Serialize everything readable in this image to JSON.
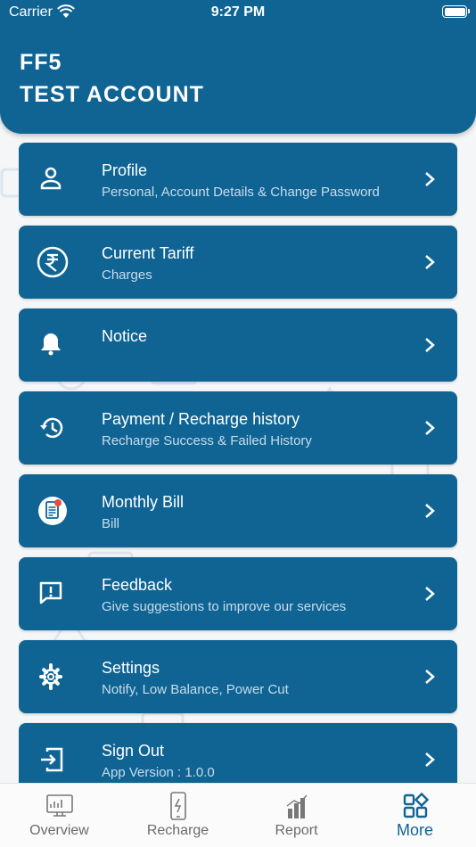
{
  "status_bar": {
    "carrier": "Carrier",
    "time": "9:27 PM"
  },
  "account": {
    "code": "FF5",
    "name": "TEST ACCOUNT"
  },
  "menu": [
    {
      "title": "Profile",
      "subtitle": "Personal, Account Details & Change Password",
      "icon": "person-icon"
    },
    {
      "title": "Current Tariff",
      "subtitle": "Charges",
      "icon": "rupee-icon"
    },
    {
      "title": "Notice",
      "subtitle": "",
      "icon": "bell-icon"
    },
    {
      "title": "Payment / Recharge history",
      "subtitle": "Recharge Success & Failed History",
      "icon": "history-icon"
    },
    {
      "title": "Monthly Bill",
      "subtitle": "Bill",
      "icon": "bill-icon"
    },
    {
      "title": "Feedback",
      "subtitle": "Give suggestions to improve our services",
      "icon": "feedback-icon"
    },
    {
      "title": "Settings",
      "subtitle": "Notify, Low Balance, Power Cut",
      "icon": "gear-icon"
    },
    {
      "title": "Sign Out",
      "subtitle": "App Version : 1.0.0",
      "icon": "sign-out-icon"
    }
  ],
  "tabs": [
    {
      "label": "Overview",
      "icon": "monitor-icon",
      "active": false
    },
    {
      "label": "Recharge",
      "icon": "phone-icon",
      "active": false
    },
    {
      "label": "Report",
      "icon": "bar-chart-icon",
      "active": false
    },
    {
      "label": "More",
      "icon": "grid-icon",
      "active": true
    }
  ],
  "colors": {
    "primary": "#0f6494",
    "subtitle": "#c8dceb",
    "background": "#f4f6f7",
    "tab_inactive": "#6b6b6b"
  }
}
